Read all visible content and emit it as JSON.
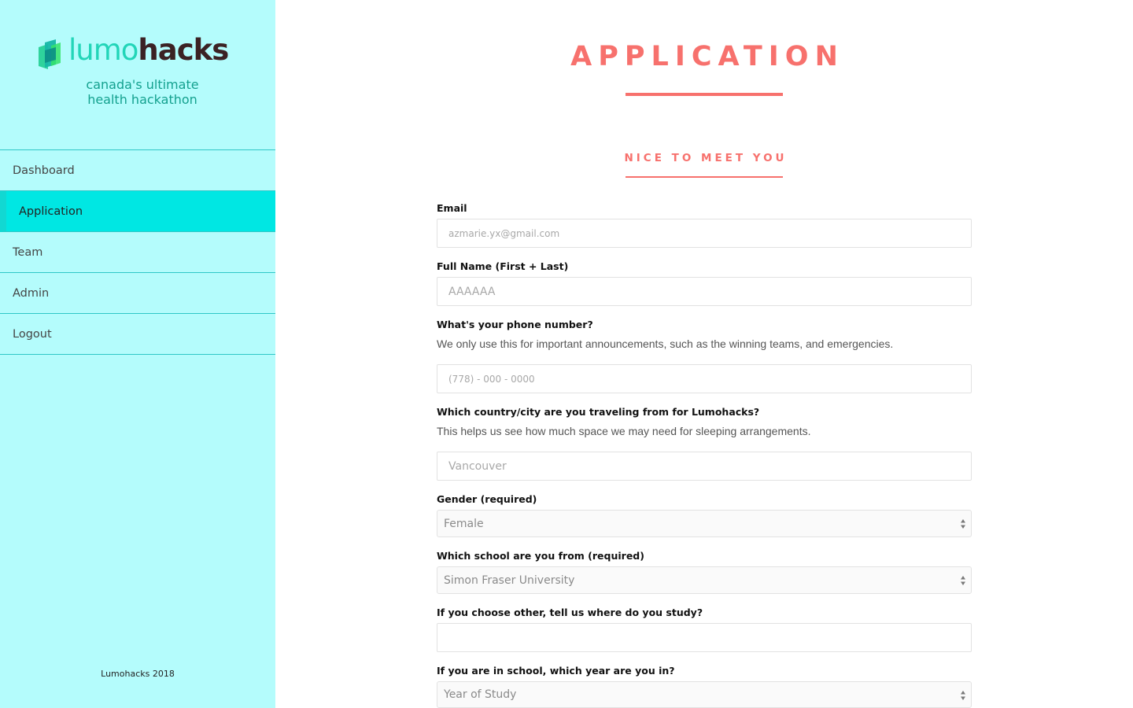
{
  "brand": {
    "name_part1": "lumo",
    "name_part2": "hacks",
    "tagline_line1": "canada's ultimate",
    "tagline_line2": "health hackathon"
  },
  "sidebar": {
    "items": [
      {
        "label": "Dashboard",
        "active": false
      },
      {
        "label": "Application",
        "active": true
      },
      {
        "label": "Team",
        "active": false
      },
      {
        "label": "Admin",
        "active": false
      },
      {
        "label": "Logout",
        "active": false
      }
    ],
    "footer": "Lumohacks 2018"
  },
  "main": {
    "title": "APPLICATION",
    "section_title": "NICE TO MEET YOU",
    "fields": {
      "email": {
        "label": "Email",
        "placeholder": "azmarie.yx@gmail.com"
      },
      "full_name": {
        "label": "Full Name (First + Last)",
        "placeholder": "AAAAAA"
      },
      "phone": {
        "label": "What's your phone number?",
        "hint": "We only use this for important announcements, such as the winning teams, and emergencies.",
        "placeholder": "(778) - 000 - 0000"
      },
      "location": {
        "label": "Which country/city are you traveling from for Lumohacks?",
        "hint": "This helps us see how much space we may need for sleeping arrangements.",
        "placeholder": "Vancouver"
      },
      "gender": {
        "label": "Gender (required)",
        "value": "Female"
      },
      "school": {
        "label": "Which school are you from (required)",
        "value": "Simon Fraser University"
      },
      "other_school": {
        "label": "If you choose other, tell us where do you study?",
        "placeholder": ""
      },
      "year": {
        "label": "If you are in school, which year are you in?",
        "value": "Year of Study"
      }
    }
  },
  "colors": {
    "sidebar_bg": "#b4fcfc",
    "active_item": "#00e7e3",
    "accent": "#f7716d",
    "brand_teal": "#22d5b8",
    "brand_dark": "#3b2224"
  }
}
